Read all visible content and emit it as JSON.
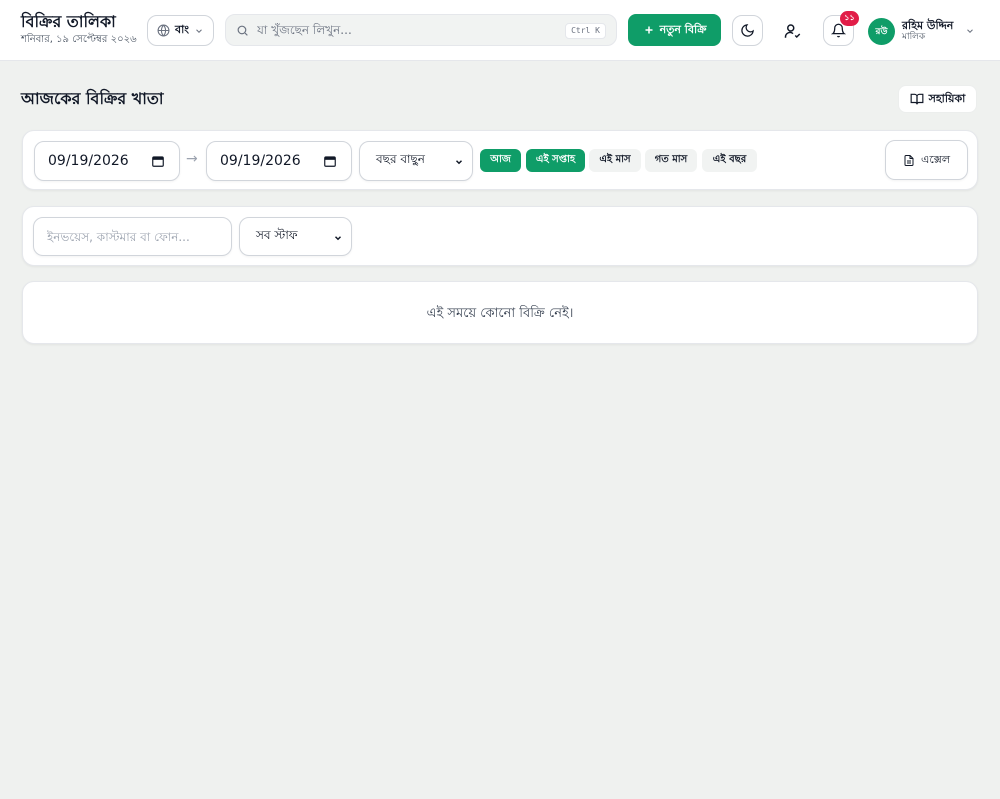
{
  "header": {
    "title": "বিক্রির তালিকা",
    "date": "শনিবার, ১৯ সেপ্টেম্বর ২০২৬",
    "language_label": "বাং",
    "search_placeholder": "যা খুঁজছেন লিখুন...",
    "search_shortcut": "Ctrl K",
    "new_sale_label": "নতুন বিক্রি",
    "notification_count": "১১",
    "user": {
      "initials": "রউ",
      "name": "রহিম উদ্দিন",
      "role": "মালিক"
    },
    "icons": [
      "globe-icon",
      "search-icon",
      "plus-icon",
      "moon-icon",
      "user-check-icon",
      "bell-icon",
      "chevron-down-icon"
    ]
  },
  "page": {
    "title": "আজকের বিক্রির খাতা",
    "guide_label": "সহায়িকা"
  },
  "filters": {
    "date_from": "09/19/2026",
    "date_to": "09/19/2026",
    "date_separator": "→",
    "year_select": "বছর বাছুন",
    "chips": [
      {
        "label": "আজ",
        "active": true
      },
      {
        "label": "এই সপ্তাহ",
        "active": true
      },
      {
        "label": "এই মাস",
        "active": false
      },
      {
        "label": "গত মাস",
        "active": false
      },
      {
        "label": "এই বছর",
        "active": false
      }
    ],
    "excel_label": "এক্সেল"
  },
  "search_filters": {
    "query_placeholder": "ইনভয়েস, কাস্টমার বা ফোন...",
    "staff_select": "সব স্টাফ"
  },
  "results": {
    "empty_message": "এই সময়ে কোনো বিক্রি নেই।"
  },
  "colors": {
    "accent": "#0f9d68",
    "badge": "#e11d48",
    "background": "#eff1ef"
  }
}
